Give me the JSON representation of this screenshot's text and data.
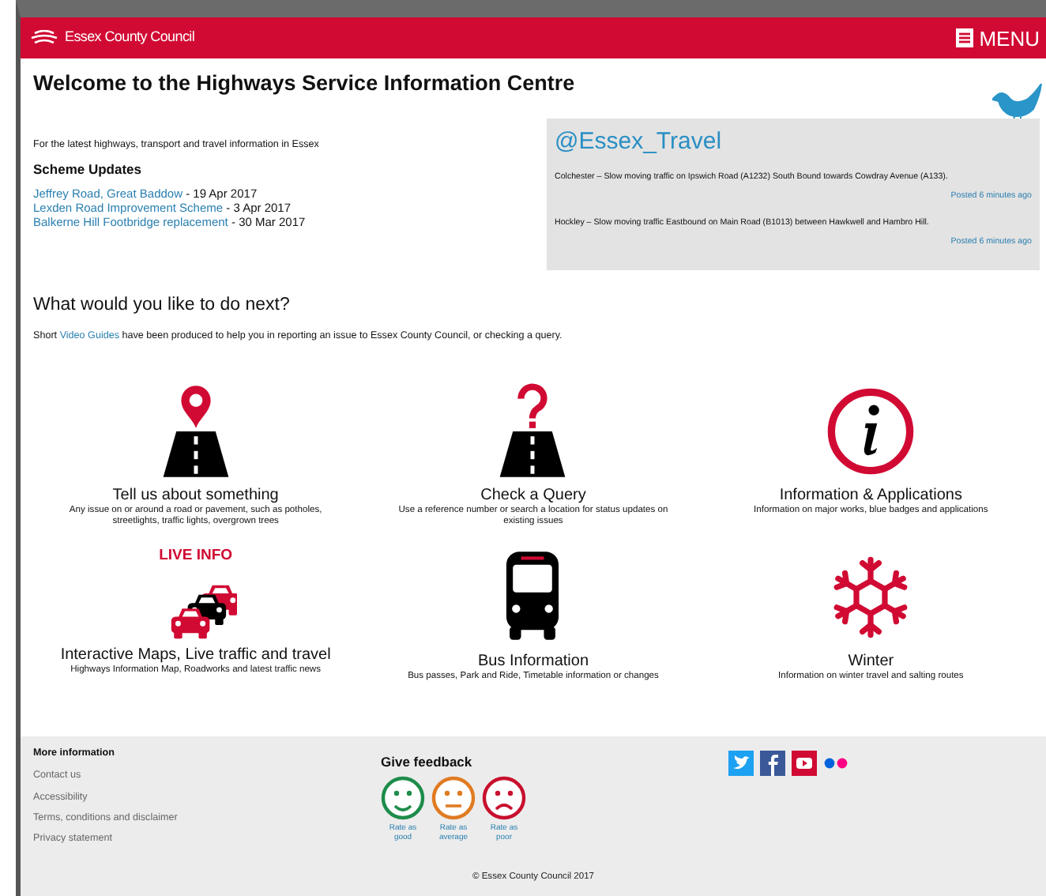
{
  "header": {
    "brand": "Essex County Council",
    "menu": "MENU"
  },
  "title": "Welcome to the Highways Service Information Centre",
  "intro": "For the latest highways, transport and travel information in Essex",
  "scheme_updates": {
    "heading": "Scheme Updates",
    "items": [
      {
        "link": "Jeffrey Road, Great Baddow",
        "date": " - 19 Apr 2017"
      },
      {
        "link": "Lexden Road Improvement Scheme",
        "date": " - 3 Apr 2017"
      },
      {
        "link": "Balkerne Hill Footbridge replacement",
        "date": " - 30 Mar 2017"
      }
    ]
  },
  "twitter": {
    "handle": "@Essex_Travel",
    "tweets": [
      {
        "text": "Colchester – Slow moving traffic on Ipswich Road (A1232) South Bound towards Cowdray Avenue (A133).",
        "posted": "Posted 6 minutes ago"
      },
      {
        "text": "Hockley – Slow moving traffic Eastbound on Main Road (B1013) between Hawkwell and Hambro Hill.",
        "posted": "Posted 6 minutes ago"
      }
    ]
  },
  "next": {
    "heading": "What would you like to do next?",
    "before": "Short ",
    "link": "Video Guides",
    "after": " have been produced to help you in reporting an issue to Essex County Council, or checking a query."
  },
  "tiles": [
    {
      "kind": "report",
      "title": "Tell us about something",
      "text": "Any issue on or around a road or pavement, such as potholes, streetlights, traffic lights, overgrown trees"
    },
    {
      "kind": "query",
      "title": "Check a Query",
      "text": "Use a reference number or search a location for status updates on existing issues"
    },
    {
      "kind": "info",
      "title": "Information & Applications",
      "text": "Information on major works, blue badges and applications"
    },
    {
      "kind": "live",
      "badge": "LIVE INFO",
      "title": "Interactive Maps, Live traffic and travel",
      "text": "Highways Information Map, Roadworks and latest traffic news"
    },
    {
      "kind": "bus",
      "title": "Bus Information",
      "text": "Bus passes, Park and Ride, Timetable information or changes"
    },
    {
      "kind": "winter",
      "title": "Winter",
      "text": "Information on winter travel and salting routes"
    }
  ],
  "footer": {
    "more_heading": "More information",
    "links": [
      "Contact us",
      "Accessibility",
      "Terms, conditions and disclaimer",
      "Privacy statement"
    ],
    "feedback_heading": "Give feedback",
    "ratings": [
      {
        "kind": "happy",
        "color": "#1e8c4a",
        "label": "Rate as good"
      },
      {
        "kind": "neutral",
        "color": "#e07b22",
        "label": "Rate as average"
      },
      {
        "kind": "sad",
        "color": "#c8102e",
        "label": "Rate as poor"
      }
    ],
    "social": [
      {
        "kind": "twitter"
      },
      {
        "kind": "facebook"
      },
      {
        "kind": "youtube"
      },
      {
        "kind": "flickr"
      }
    ],
    "copyright": "© Essex County Council 2017"
  }
}
